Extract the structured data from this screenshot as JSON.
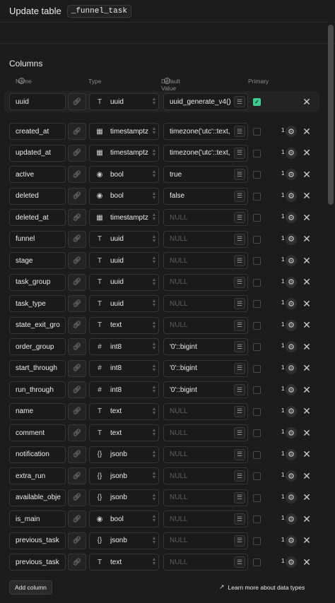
{
  "header": {
    "title": "Update table",
    "table_name": "_funnel_task"
  },
  "section": {
    "title": "Columns"
  },
  "column_headers": {
    "name": "Name",
    "type": "Type",
    "default_value": "Default Value",
    "primary": "Primary"
  },
  "rows": [
    {
      "name": "uuid",
      "type": "uuid",
      "type_icon": "text-type-icon",
      "default": "uuid_generate_v4()",
      "default_empty": false,
      "primary": true,
      "show_settings": false,
      "count": ""
    },
    {
      "name": "created_at",
      "type": "timestamptz",
      "type_icon": "calendar-icon",
      "default": "timezone('utc'::text,",
      "default_empty": false,
      "primary": false,
      "show_settings": true,
      "count": "1"
    },
    {
      "name": "updated_at",
      "type": "timestamptz",
      "type_icon": "calendar-icon",
      "default": "timezone('utc'::text,",
      "default_empty": false,
      "primary": false,
      "show_settings": true,
      "count": "1"
    },
    {
      "name": "active",
      "type": "bool",
      "type_icon": "toggle-icon",
      "default": "true",
      "default_empty": false,
      "primary": false,
      "show_settings": true,
      "count": "1"
    },
    {
      "name": "deleted",
      "type": "bool",
      "type_icon": "toggle-icon",
      "default": "false",
      "default_empty": false,
      "primary": false,
      "show_settings": true,
      "count": "1"
    },
    {
      "name": "deleted_at",
      "type": "timestamptz",
      "type_icon": "calendar-icon",
      "default": "NULL",
      "default_empty": true,
      "primary": false,
      "show_settings": true,
      "count": "1"
    },
    {
      "name": "funnel",
      "type": "uuid",
      "type_icon": "text-type-icon",
      "default": "NULL",
      "default_empty": true,
      "primary": false,
      "show_settings": true,
      "count": "1"
    },
    {
      "name": "stage",
      "type": "uuid",
      "type_icon": "text-type-icon",
      "default": "NULL",
      "default_empty": true,
      "primary": false,
      "show_settings": true,
      "count": "1"
    },
    {
      "name": "task_group",
      "type": "uuid",
      "type_icon": "text-type-icon",
      "default": "NULL",
      "default_empty": true,
      "primary": false,
      "show_settings": true,
      "count": "1"
    },
    {
      "name": "task_type",
      "type": "uuid",
      "type_icon": "text-type-icon",
      "default": "NULL",
      "default_empty": true,
      "primary": false,
      "show_settings": true,
      "count": "1"
    },
    {
      "name": "state_exit_gro",
      "type": "text",
      "type_icon": "text-type-icon",
      "default": "NULL",
      "default_empty": true,
      "primary": false,
      "show_settings": true,
      "count": "1"
    },
    {
      "name": "order_group",
      "type": "int8",
      "type_icon": "hash-icon",
      "default": "'0'::bigint",
      "default_empty": false,
      "primary": false,
      "show_settings": true,
      "count": "1"
    },
    {
      "name": "start_through",
      "type": "int8",
      "type_icon": "hash-icon",
      "default": "'0'::bigint",
      "default_empty": false,
      "primary": false,
      "show_settings": true,
      "count": "1"
    },
    {
      "name": "run_through",
      "type": "int8",
      "type_icon": "hash-icon",
      "default": "'0'::bigint",
      "default_empty": false,
      "primary": false,
      "show_settings": true,
      "count": "1"
    },
    {
      "name": "name",
      "type": "text",
      "type_icon": "text-type-icon",
      "default": "NULL",
      "default_empty": true,
      "primary": false,
      "show_settings": true,
      "count": "1"
    },
    {
      "name": "comment",
      "type": "text",
      "type_icon": "text-type-icon",
      "default": "NULL",
      "default_empty": true,
      "primary": false,
      "show_settings": true,
      "count": "1"
    },
    {
      "name": "notification",
      "type": "jsonb",
      "type_icon": "braces-icon",
      "default": "NULL",
      "default_empty": true,
      "primary": false,
      "show_settings": true,
      "count": "1"
    },
    {
      "name": "extra_run",
      "type": "jsonb",
      "type_icon": "braces-icon",
      "default": "NULL",
      "default_empty": true,
      "primary": false,
      "show_settings": true,
      "count": "1"
    },
    {
      "name": "available_obje",
      "type": "jsonb",
      "type_icon": "braces-icon",
      "default": "NULL",
      "default_empty": true,
      "primary": false,
      "show_settings": true,
      "count": "1"
    },
    {
      "name": "is_main",
      "type": "bool",
      "type_icon": "toggle-icon",
      "default": "NULL",
      "default_empty": true,
      "primary": false,
      "show_settings": true,
      "count": "1"
    },
    {
      "name": "previous_task",
      "type": "jsonb",
      "type_icon": "braces-icon",
      "default": "NULL",
      "default_empty": true,
      "primary": false,
      "show_settings": true,
      "count": "1"
    },
    {
      "name": "previous_task",
      "type": "text",
      "type_icon": "text-type-icon",
      "default": "NULL",
      "default_empty": true,
      "primary": false,
      "show_settings": true,
      "count": "1"
    }
  ],
  "footer": {
    "add_column": "Add column",
    "learn_more": "Learn more about data types"
  },
  "colors": {
    "background": "#1c1c1c",
    "accent_green": "#3ecf8e",
    "border": "#363636"
  }
}
